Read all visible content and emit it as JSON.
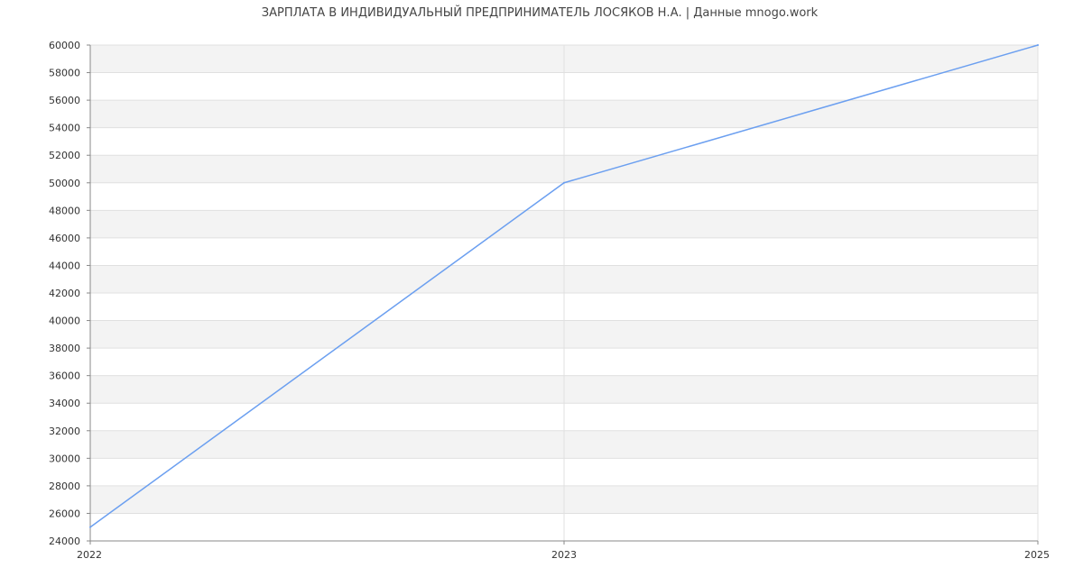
{
  "colors": {
    "line": "#6b9ff0",
    "band_fill": "#f3f3f3",
    "grid_line": "#e0e0e0",
    "axis_line": "#888888"
  },
  "chart_data": {
    "type": "line",
    "title": "ЗАРПЛАТА В ИНДИВИДУАЛЬНЫЙ ПРЕДПРИНИМАТЕЛЬ ЛОСЯКОВ Н.А. | Данные mnogo.work",
    "xlabel": "",
    "ylabel": "",
    "x": [
      2022,
      2023,
      2025
    ],
    "series": [
      {
        "values": [
          25000,
          50000,
          60000
        ]
      }
    ],
    "x_ticks": [
      "2022",
      "2023",
      "2025"
    ],
    "xlim": [
      2022,
      2025
    ],
    "x_scale": "categorical-equal-spacing",
    "ylim": [
      24000,
      60000
    ],
    "y_ticks": [
      24000,
      26000,
      28000,
      30000,
      32000,
      34000,
      36000,
      38000,
      40000,
      42000,
      44000,
      46000,
      48000,
      50000,
      52000,
      54000,
      56000,
      58000,
      60000
    ],
    "grid": true,
    "banded_background": true,
    "legend": "none"
  }
}
